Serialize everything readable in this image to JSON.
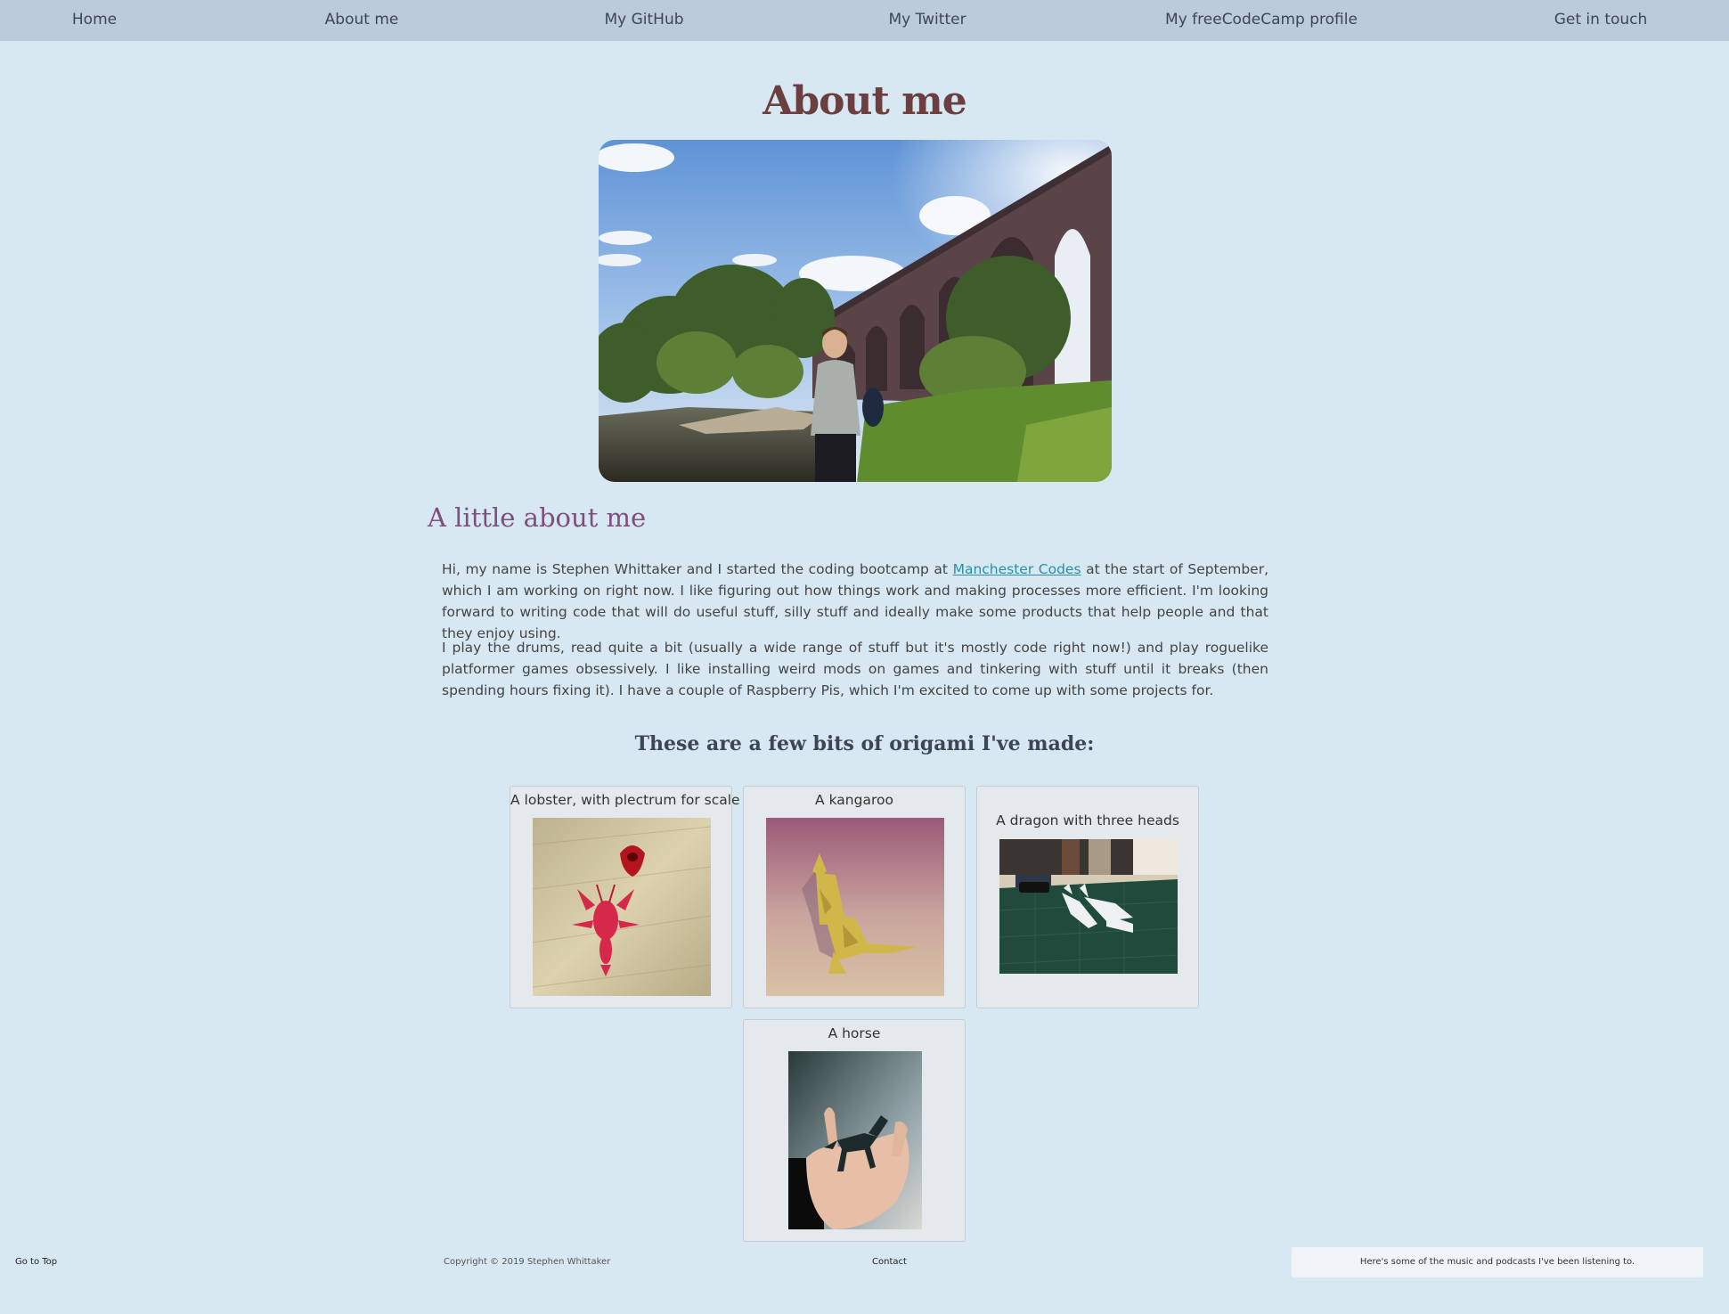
{
  "nav": {
    "items": [
      {
        "label": "Home"
      },
      {
        "label": "About me"
      },
      {
        "label": "My GitHub"
      },
      {
        "label": "My Twitter"
      },
      {
        "label": "My freeCodeCamp profile"
      },
      {
        "label": "Get in touch"
      }
    ]
  },
  "page": {
    "title": "About me"
  },
  "about": {
    "heading": "A little about me",
    "p1_before": "Hi, my name is Stephen Whittaker and I started the coding bootcamp at ",
    "p1_link": "Manchester Codes",
    "p1_after": " at the start of September, which I am working on right now. I like figuring out how things work and making processes more efficient. I'm looking forward to writing code that will do useful stuff, silly stuff and ideally make some products that help people and that they enjoy using.",
    "p2": "I play the drums, read quite a bit (usually a wide range of stuff but it's mostly code right now!) and play roguelike platformer games obsessively. I like installing weird mods on games and tinkering with stuff until it breaks (then spending hours fixing it). I have a couple of Raspberry Pis, which I'm excited to come up with some projects for."
  },
  "origami": {
    "heading": "These are a few bits of origami I've made:",
    "items": [
      {
        "caption": "A lobster, with plectrum for scale"
      },
      {
        "caption": "A kangaroo"
      },
      {
        "caption": "A dragon with three heads"
      },
      {
        "caption": "A horse"
      }
    ]
  },
  "footer": {
    "go_top": "Go to Top",
    "copyright": "Copyright © 2019 Stephen Whittaker",
    "contact": "Contact",
    "listening": "Here's some of the music and podcasts I've been listening to."
  },
  "colors": {
    "background": "#d7e8f2",
    "nav_background": "#bccbdc",
    "title": "#6b3f3f",
    "section_title": "#7d4f7c",
    "link": "#2a8fa6"
  }
}
